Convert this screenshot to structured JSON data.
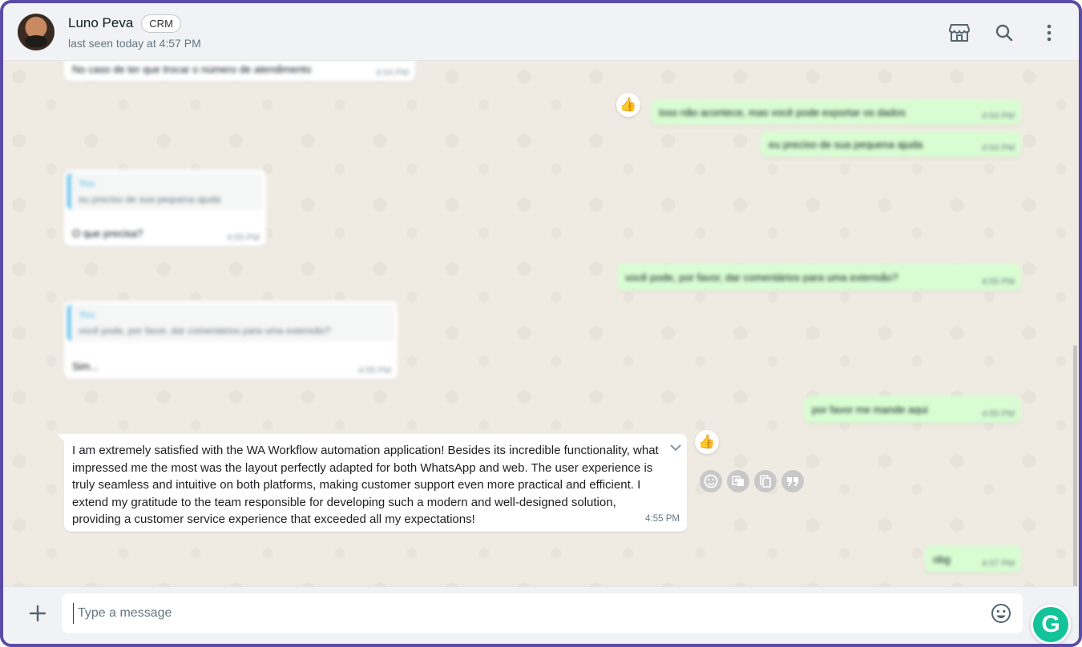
{
  "header": {
    "contact_name": "Luno Peva",
    "badge": "CRM",
    "status": "last seen today at 4:57 PM",
    "icons": [
      "store-icon",
      "search-icon",
      "menu-dots-icon"
    ]
  },
  "messages": {
    "m1": {
      "text": "No caso de ter que trocar o número de atendimento",
      "time": "4:54 PM"
    },
    "m2": {
      "text": "isso não acontece, mas você pode exportar os dados",
      "time": "4:54 PM",
      "reaction": "👍"
    },
    "m3": {
      "text": "eu preciso de sua pequena ajuda",
      "time": "4:54 PM"
    },
    "m4": {
      "quote_author": "You",
      "quote_text": "eu preciso de sua pequena ajuda",
      "text": "O que precisa?",
      "time": "4:55 PM"
    },
    "m5": {
      "text": "você pode, por favor, dar comentários para uma extensão?",
      "time": "4:55 PM"
    },
    "m6": {
      "quote_author": "You",
      "quote_text": "você pode, por favor, dar comentários para uma extensão?",
      "text": "Sim...",
      "time": "4:55 PM"
    },
    "m7": {
      "text": "por favor me mande aqui",
      "time": "4:55 PM"
    },
    "m8": {
      "text": "I am extremely satisfied with the WA Workflow automation application! Besides its incredible functionality, what impressed me the most was the layout perfectly adapted for both WhatsApp and web. The user experience is truly seamless and intuitive on both platforms, making customer support even more practical and efficient. I extend my gratitude to the team responsible for developing such a modern and well-designed solution, providing a customer service experience that exceeded all my expectations!",
      "time": "4:55 PM",
      "reaction": "👍"
    },
    "m9": {
      "text": "obg",
      "time": "4:57 PM"
    }
  },
  "actions": [
    "emoji-icon",
    "translate-icon",
    "copy-icon",
    "quote-icon"
  ],
  "composer": {
    "placeholder": "Type a message",
    "grammarly_letter": "G"
  }
}
